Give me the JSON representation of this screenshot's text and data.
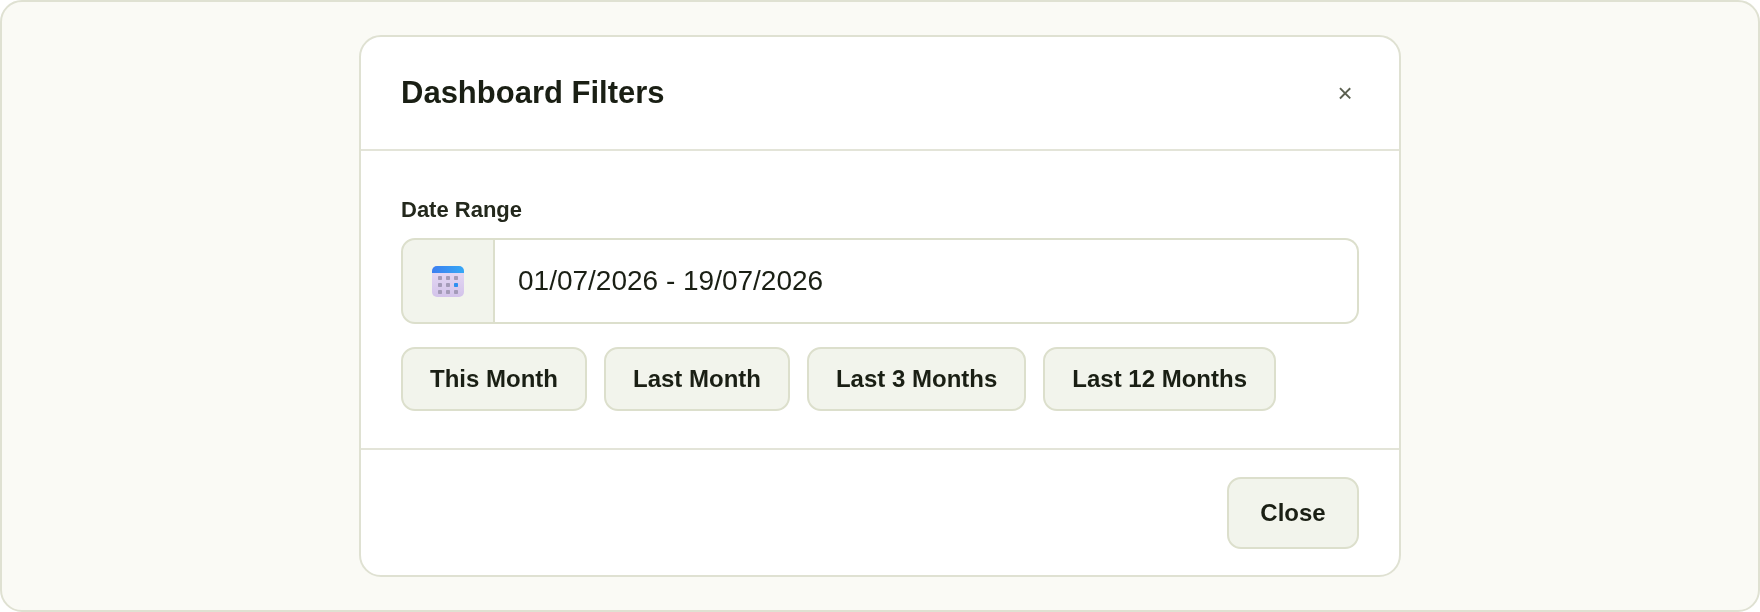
{
  "dialog": {
    "title": "Dashboard Filters",
    "close_label": "×"
  },
  "date_range": {
    "label": "Date Range",
    "value": "01/07/2026 - 19/07/2026"
  },
  "presets": [
    {
      "label": "This Month"
    },
    {
      "label": "Last Month"
    },
    {
      "label": "Last 3 Months"
    },
    {
      "label": "Last 12 Months"
    }
  ],
  "footer": {
    "buttons": [
      "Close"
    ]
  }
}
